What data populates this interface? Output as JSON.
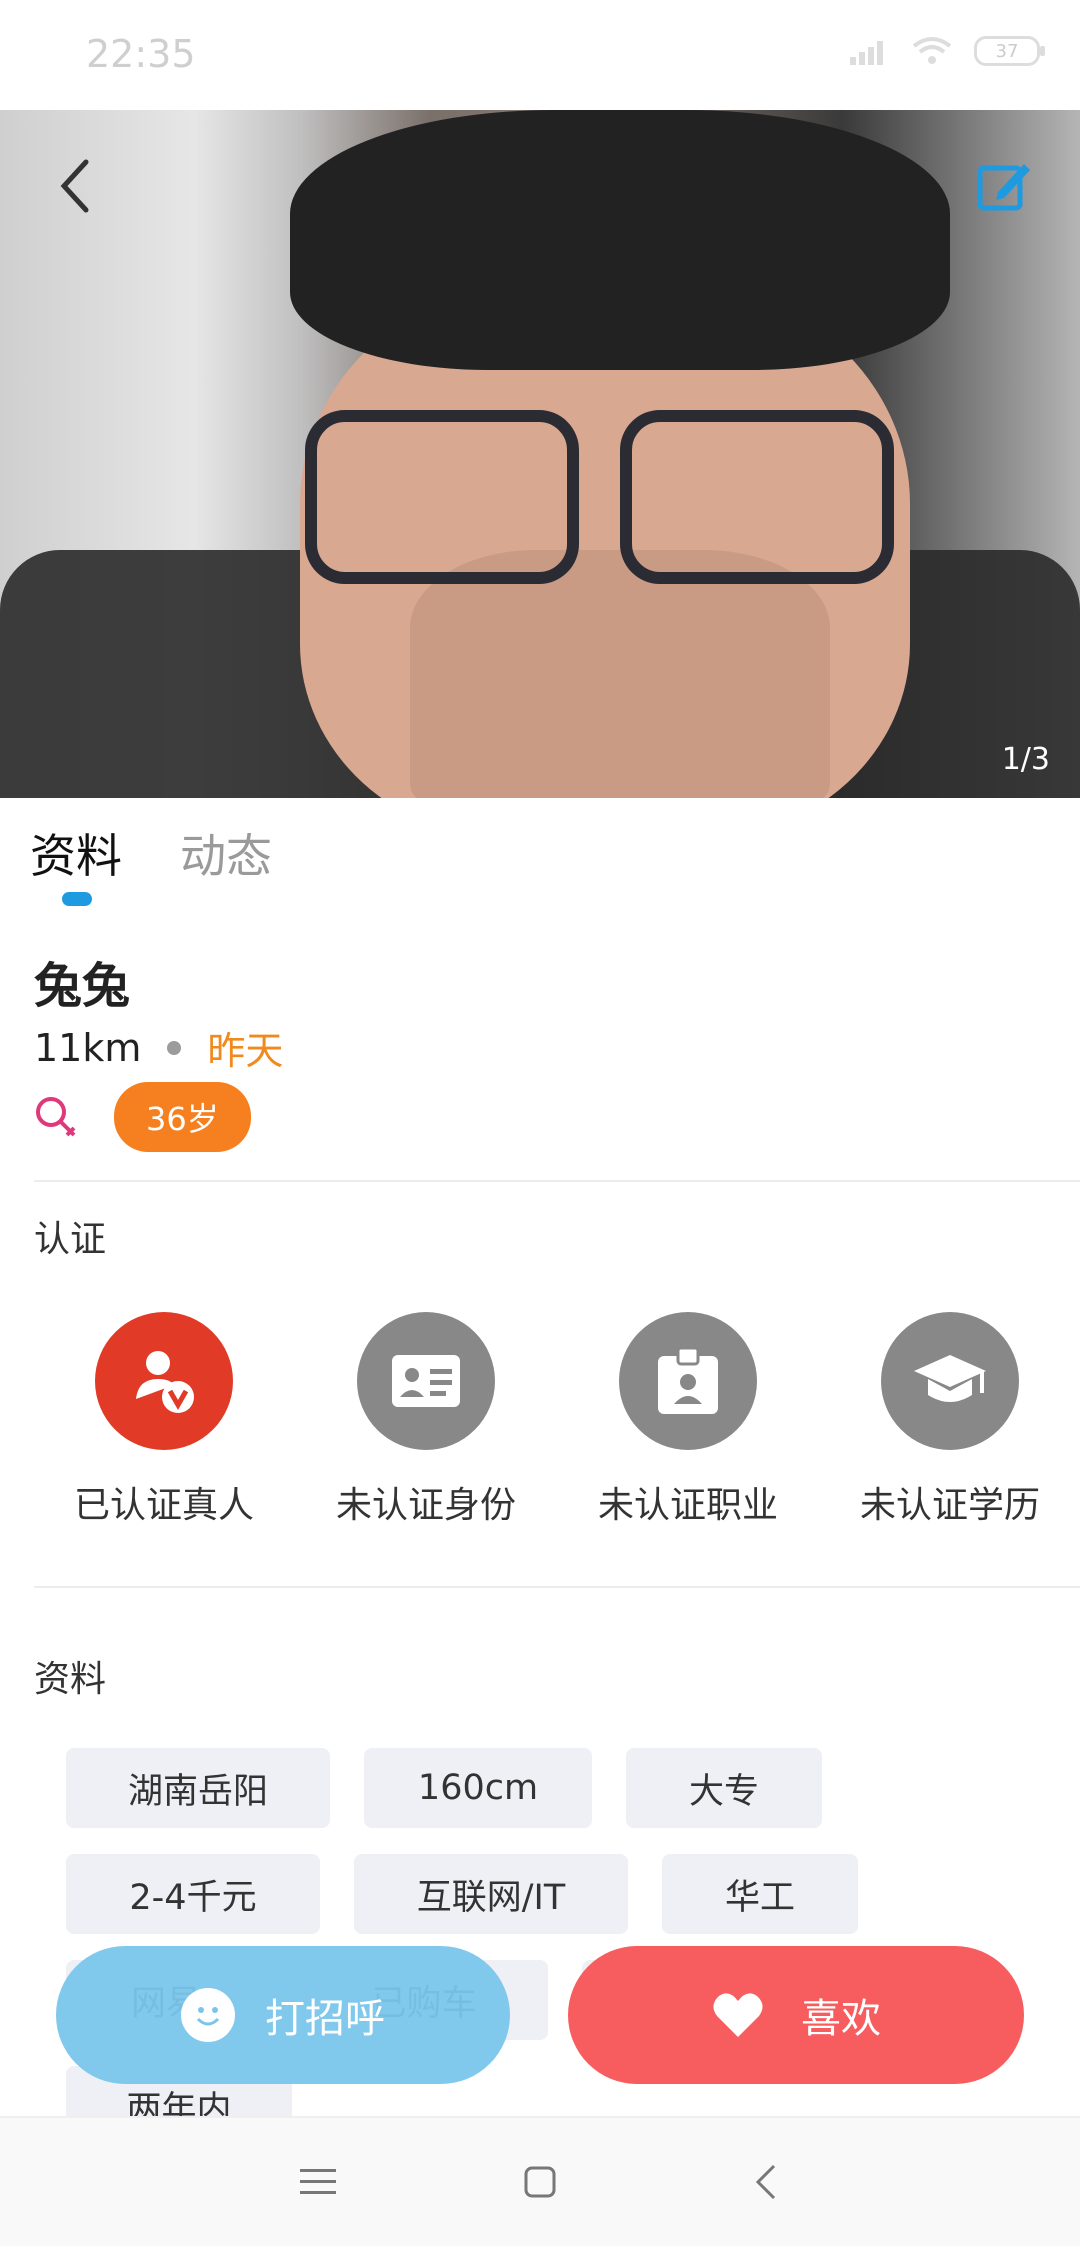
{
  "status_bar": {
    "time": "22:35",
    "battery": "37"
  },
  "photo": {
    "counter": "1/3"
  },
  "tabs": [
    {
      "label": "资料"
    },
    {
      "label": "动态"
    }
  ],
  "profile": {
    "name": "兔兔",
    "distance": "11km",
    "last_seen": "昨天",
    "age": "36岁"
  },
  "certification": {
    "title": "认证",
    "items": [
      {
        "label": "已认证真人",
        "icon": "verified-person-icon",
        "verified": true
      },
      {
        "label": "未认证身份",
        "icon": "id-card-icon",
        "verified": false
      },
      {
        "label": "未认证职业",
        "icon": "work-badge-icon",
        "verified": false
      },
      {
        "label": "未认证学历",
        "icon": "graduation-cap-icon",
        "verified": false
      }
    ]
  },
  "details": {
    "title": "资料",
    "rows": [
      [
        "湖南岳阳",
        "160cm",
        "大专"
      ],
      [
        "2-4千元",
        "互联网/IT",
        "华工"
      ],
      [
        "网易",
        "已购车",
        ""
      ],
      [
        "两年内"
      ]
    ]
  },
  "actions": {
    "greet_label": "打招呼",
    "like_label": "喜欢"
  },
  "colors": {
    "accent": "#1e9ae0",
    "age_badge": "#f6801f",
    "verified": "#e13a26",
    "like": "#f75d5e",
    "greet": "#7ac6eb"
  }
}
